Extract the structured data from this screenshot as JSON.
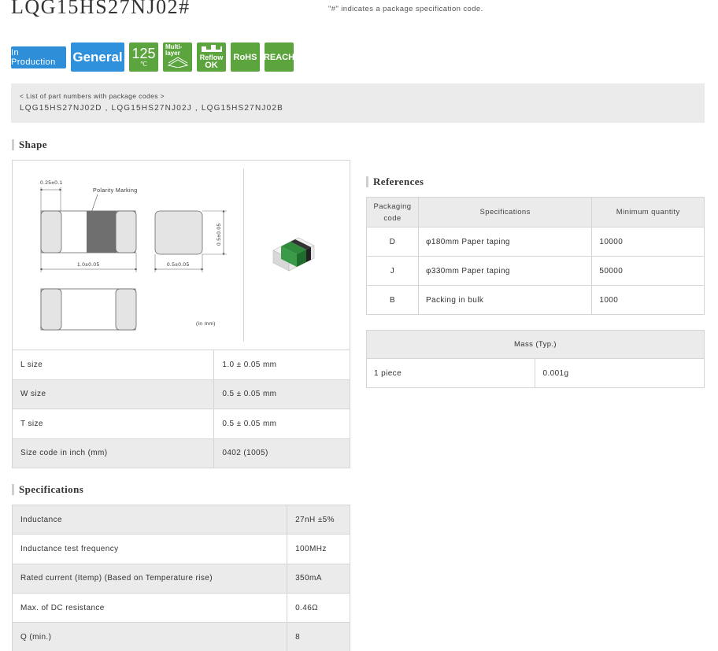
{
  "header": {
    "title": "LQG15HS27NJ02#",
    "note": "\"#\" indicates a package specification code."
  },
  "badges": {
    "production": "In Production",
    "general": "General",
    "temp_value": "125",
    "temp_unit": "℃",
    "multilayer": "Multi-\nlayer",
    "reflow_top": "Reflow",
    "reflow_ok": "OK",
    "rohs": "RoHS",
    "reach": "REACH"
  },
  "part_numbers": {
    "heading": "< List of part numbers with package codes >",
    "list": "LQG15HS27NJ02D , LQG15HS27NJ02J , LQG15HS27NJ02B"
  },
  "shape": {
    "title": "Shape",
    "drawing": {
      "dim_top": "0.25±0.1",
      "polarity": "Polarity Marking",
      "dim_length": "1.0±0.05",
      "dim_width": "0.5±0.05",
      "dim_height": "0.5±0.05",
      "unit_note": "(in mm)"
    },
    "rows": [
      {
        "label": "L size",
        "value": "1.0 ± 0.05 mm"
      },
      {
        "label": "W size",
        "value": "0.5 ± 0.05 mm"
      },
      {
        "label": "T size",
        "value": "0.5 ± 0.05 mm"
      },
      {
        "label": "Size code in inch (mm)",
        "value": "0402 (1005)"
      }
    ]
  },
  "specifications": {
    "title": "Specifications",
    "rows": [
      {
        "label": "Inductance",
        "value": "27nH ±5%"
      },
      {
        "label": "Inductance test frequency",
        "value": "100MHz"
      },
      {
        "label": "Rated current (Itemp) (Based on Temperature rise)",
        "value": "350mA"
      },
      {
        "label": "Max. of DC resistance",
        "value": "0.46Ω"
      },
      {
        "label": "Q (min.)",
        "value": "8"
      }
    ]
  },
  "references": {
    "title": "References",
    "headers": {
      "code": "Packaging code",
      "spec": "Specifications",
      "qty": "Minimum quantity"
    },
    "rows": [
      {
        "code": "D",
        "spec": "φ180mm Paper taping",
        "qty": "10000"
      },
      {
        "code": "J",
        "spec": "φ330mm Paper taping",
        "qty": "50000"
      },
      {
        "code": "B",
        "spec": "Packing in bulk",
        "qty": "1000"
      }
    ]
  },
  "mass": {
    "header": "Mass (Typ.)",
    "label": "1 piece",
    "value": "0.001g"
  },
  "colors": {
    "badge_blue": "#2e8fd8",
    "badge_green": "#5ca43e",
    "table_shade": "#ebebeb",
    "border": "#d5d5d5"
  }
}
